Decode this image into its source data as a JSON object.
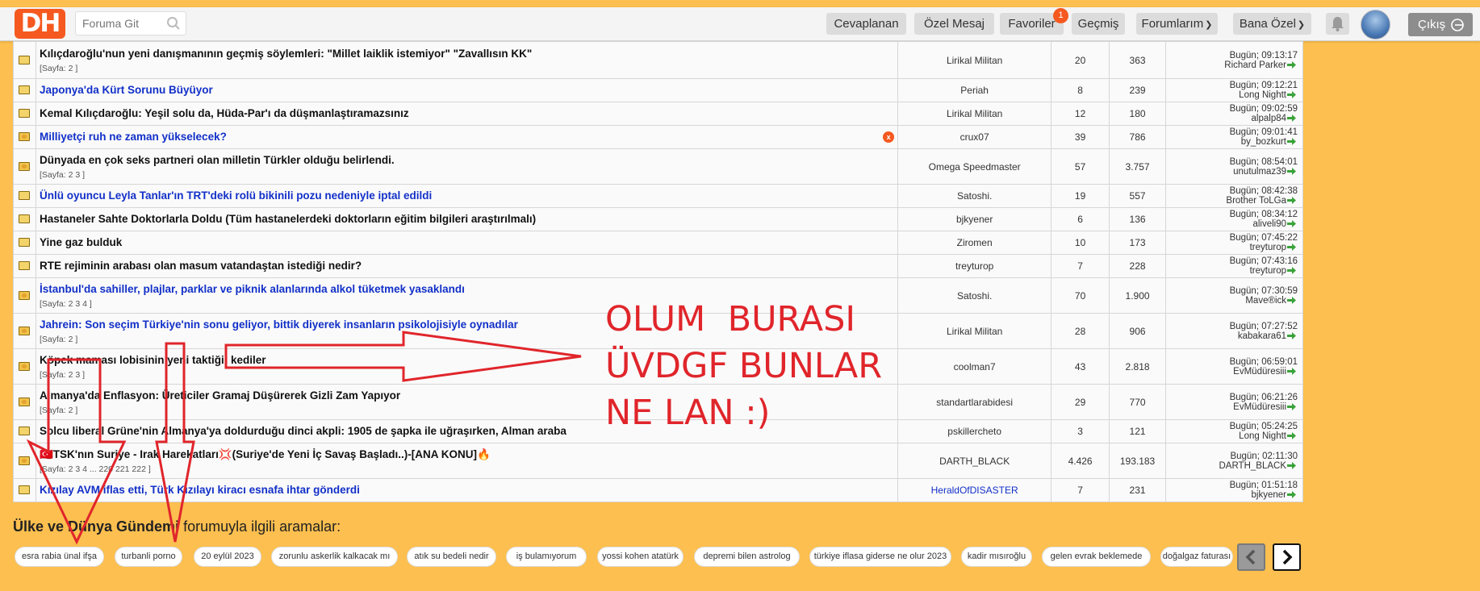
{
  "header": {
    "logo": "DH",
    "search_placeholder": "Foruma Git",
    "nav": {
      "answered": "Cevaplanan",
      "private_msg": "Özel Mesaj",
      "favorites": "Favoriler",
      "favorites_badge": "1",
      "history": "Geçmiş",
      "my_forums": "Forumlarım",
      "mine": "Bana Özel"
    },
    "logout": "Çıkış"
  },
  "topics": [
    {
      "title": "Kılıçdaroğlu'nun yeni danışmanının geçmiş söylemleri: \"Millet laiklik istemiyor\" \"Zavallısın KK\"",
      "pages": "[Sayfa: 2 ]",
      "author": "Lirikal Militan",
      "replies": "20",
      "views": "363",
      "last_time": "Bugün; 09:13:17",
      "last_user": "Richard Parker",
      "blue": false,
      "hot": false
    },
    {
      "title": "Japonya'da Kürt Sorunu Büyüyor",
      "pages": "",
      "author": "Periah",
      "replies": "8",
      "views": "239",
      "last_time": "Bugün; 09:12:21",
      "last_user": "Long Nightt",
      "blue": true,
      "hot": false
    },
    {
      "title": "Kemal Kılıçdaroğlu: Yeşil solu da, Hüda-Par'ı da düşmanlaştıramazsınız",
      "pages": "",
      "author": "Lirikal Militan",
      "replies": "12",
      "views": "180",
      "last_time": "Bugün; 09:02:59",
      "last_user": "alpalp84",
      "blue": false,
      "hot": false
    },
    {
      "title": "Milliyetçi ruh ne zaman yükselecek?",
      "pages": "",
      "author": "crux07",
      "replies": "39",
      "views": "786",
      "last_time": "Bugün; 09:01:41",
      "last_user": "by_bozkurt",
      "blue": true,
      "hot": true,
      "xbadge": "x"
    },
    {
      "title": "Dünyada en çok seks partneri olan milletin Türkler olduğu belirlendi.",
      "pages": "[Sayfa: 2 3 ]",
      "author": "Omega Speedmaster",
      "replies": "57",
      "views": "3.757",
      "last_time": "Bugün; 08:54:01",
      "last_user": "unutulmaz39",
      "blue": false,
      "hot": true
    },
    {
      "title": "Ünlü oyuncu Leyla Tanlar'ın TRT'deki rolü bikinili pozu nedeniyle iptal edildi",
      "pages": "",
      "author": "Satoshi.",
      "replies": "19",
      "views": "557",
      "last_time": "Bugün; 08:42:38",
      "last_user": "Brother ToLGa",
      "blue": true,
      "hot": false
    },
    {
      "title": "Hastaneler Sahte Doktorlarla Doldu (Tüm hastanelerdeki doktorların eğitim bilgileri araştırılmalı)",
      "pages": "",
      "author": "bjkyener",
      "replies": "6",
      "views": "136",
      "last_time": "Bugün; 08:34:12",
      "last_user": "aliveli90",
      "blue": false,
      "hot": false
    },
    {
      "title": "Yine gaz bulduk",
      "pages": "",
      "author": "Ziromen",
      "replies": "10",
      "views": "173",
      "last_time": "Bugün; 07:45:22",
      "last_user": "treyturop",
      "blue": false,
      "hot": false
    },
    {
      "title": "RTE rejiminin arabası olan masum vatandaştan istediği nedir?",
      "pages": "",
      "author": "treyturop",
      "replies": "7",
      "views": "228",
      "last_time": "Bugün; 07:43:16",
      "last_user": "treyturop",
      "blue": false,
      "hot": false
    },
    {
      "title": "İstanbul'da sahiller, plajlar, parklar ve piknik alanlarında alkol tüketmek yasaklandı",
      "pages": "[Sayfa: 2 3 4 ]",
      "author": "Satoshi.",
      "replies": "70",
      "views": "1.900",
      "last_time": "Bugün; 07:30:59",
      "last_user": "Mave®ick",
      "blue": true,
      "hot": true
    },
    {
      "title": "Jahrein: Son seçim Türkiye'nin sonu geliyor, bittik diyerek insanların psikolojisiyle oynadılar",
      "pages": "[Sayfa: 2 ]",
      "author": "Lirikal Militan",
      "replies": "28",
      "views": "906",
      "last_time": "Bugün; 07:27:52",
      "last_user": "kabakara61",
      "blue": true,
      "hot": true
    },
    {
      "title": "Köpek maması lobisinin yeni taktiği: kediler",
      "pages": "[Sayfa: 2 3 ]",
      "author": "coolman7",
      "replies": "43",
      "views": "2.818",
      "last_time": "Bugün; 06:59:01",
      "last_user": "EvMüdüresiii",
      "blue": false,
      "hot": true
    },
    {
      "title": "Almanya'da Enflasyon: Üreticiler Gramaj Düşürerek Gizli Zam Yapıyor",
      "pages": "[Sayfa: 2 ]",
      "author": "standartlarabidesi",
      "replies": "29",
      "views": "770",
      "last_time": "Bugün; 06:21:26",
      "last_user": "EvMüdüresiii",
      "blue": false,
      "hot": true
    },
    {
      "title": "Solcu liberal Grüne'nin Almanya'ya doldurduğu dinci akpli: 1905 de şapka ile uğraşırken, Alman araba",
      "pages": "",
      "author": "pskillercheto",
      "replies": "3",
      "views": "121",
      "last_time": "Bugün; 05:24:25",
      "last_user": "Long Nightt",
      "blue": false,
      "hot": false
    },
    {
      "title": "🇹🇷TSK'nın Suriye - Irak Harekatları💢(Suriye'de Yeni İç Savaş Başladı..)-[ANA KONU]🔥",
      "pages": "[Sayfa: 2 3 4 ... 220 221 222 ]",
      "author": "DARTH_BLACK",
      "replies": "4.426",
      "views": "193.183",
      "last_time": "Bugün; 02:11:30",
      "last_user": "DARTH_BLACK",
      "blue": false,
      "hot": true
    },
    {
      "title": "Kızılay AVM iflas etti, Türk Kızılayı kiracı esnafa ihtar gönderdi",
      "pages": "",
      "author": "HeraldOfDISASTER",
      "replies": "7",
      "views": "231",
      "last_time": "Bugün; 01:51:18",
      "last_user": "bjkyener",
      "blue": true,
      "hot": false,
      "author_blue": true
    }
  ],
  "searches": {
    "heading_bold": "Ülke ve Dünya Gündemi",
    "heading_rest": " forumuyla ilgili aramalar:",
    "chips": [
      "esra rabia ünal ifşa",
      "turbanli porno",
      "20 eylül 2023",
      "zorunlu askerlik kalkacak mı",
      "atık su bedeli nedir",
      "iş bulamıyorum",
      "yossi kohen atatürk",
      "depremi bilen astrolog",
      "türkiye iflasa giderse ne olur 2023",
      "kadir mısıroğlu",
      "gelen evrak beklemede",
      "doğalgaz faturası"
    ]
  },
  "annotation": {
    "text": "OLUM  BURASI\nÜVDGF BUNLAR\nNE LAN :)",
    "color": "#e0252b"
  },
  "colors": {
    "background": "#fdbf4f",
    "brand": "#f5591f",
    "link_blue": "#1230c8"
  },
  "icons": {
    "search": "search-icon",
    "bell": "bell-icon",
    "logout": "logout-icon",
    "folder": "folder-icon"
  }
}
